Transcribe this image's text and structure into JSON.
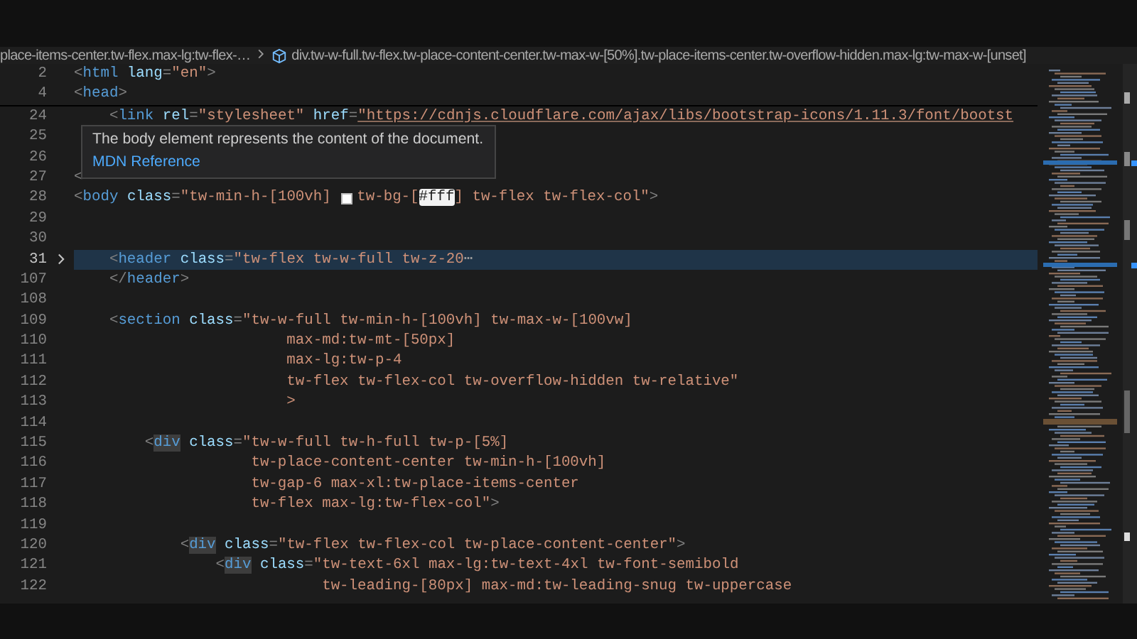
{
  "breadcrumbs": [
    {
      "text": "place-items-center.tw-flex.max-lg:tw-flex-…",
      "icon": false
    },
    {
      "text": "div.tw-w-full.tw-flex.tw-place-content-center.tw-max-w-[50%].tw-place-items-center.tw-overflow-hidden.max-lg:tw-max-w-[unset]",
      "icon": true
    }
  ],
  "sticky_lines": [
    {
      "number": "2",
      "tokens": [
        {
          "kind": "punct",
          "text": "<"
        },
        {
          "kind": "tag",
          "text": "html"
        },
        {
          "kind": "attr",
          "text": " lang"
        },
        {
          "kind": "punct",
          "text": "="
        },
        {
          "kind": "string",
          "text": "\"en\""
        },
        {
          "kind": "punct",
          "text": ">"
        }
      ]
    },
    {
      "number": "4",
      "tokens": [
        {
          "kind": "punct",
          "text": "<"
        },
        {
          "kind": "tag",
          "text": "head"
        },
        {
          "kind": "punct",
          "text": ">"
        }
      ]
    }
  ],
  "lines": [
    {
      "number": "24",
      "current": false,
      "folded": false,
      "tokens": [
        {
          "kind": "punct",
          "text": "    <"
        },
        {
          "kind": "tag",
          "text": "link"
        },
        {
          "kind": "attr",
          "text": " rel"
        },
        {
          "kind": "punct",
          "text": "="
        },
        {
          "kind": "string",
          "text": "\"stylesheet\""
        },
        {
          "kind": "attr",
          "text": " href"
        },
        {
          "kind": "punct",
          "text": "="
        },
        {
          "kind": "link",
          "text": "\"https://cdnjs.cloudflare.com/ajax/libs/bootstrap-icons/1.11.3/font/bootst"
        }
      ]
    },
    {
      "number": "25",
      "current": false,
      "folded": false
    },
    {
      "number": "26",
      "current": false,
      "folded": false
    },
    {
      "number": "27",
      "current": false,
      "folded": false,
      "tokens": [
        {
          "kind": "punct",
          "text": "<"
        }
      ]
    },
    {
      "number": "28",
      "current": false,
      "folded": false,
      "tokens": [
        {
          "kind": "punct",
          "text": "<"
        },
        {
          "kind": "tag",
          "text": "body"
        },
        {
          "kind": "attr",
          "text": " class"
        },
        {
          "kind": "punct",
          "text": "="
        },
        {
          "kind": "string",
          "text": "\"tw-min-h-[100vh] "
        },
        {
          "kind": "swatch",
          "color": "#ffffff"
        },
        {
          "kind": "string",
          "text": "tw-bg-["
        },
        {
          "kind": "selected",
          "text": "#fff"
        },
        {
          "kind": "string",
          "text": "] tw-flex tw-flex-col\""
        },
        {
          "kind": "punct",
          "text": ">"
        }
      ]
    },
    {
      "number": "29",
      "current": false,
      "folded": false
    },
    {
      "number": "30",
      "current": false,
      "folded": false
    },
    {
      "number": "31",
      "current": true,
      "folded": true,
      "tokens": [
        {
          "kind": "punct",
          "text": "    <"
        },
        {
          "kind": "tag",
          "text": "header"
        },
        {
          "kind": "attr",
          "text": " class"
        },
        {
          "kind": "punct",
          "text": "="
        },
        {
          "kind": "string",
          "text": "\"tw-flex tw-w-full tw-z-20"
        },
        {
          "kind": "ellipsis",
          "text": "⋯"
        }
      ]
    },
    {
      "number": "107",
      "current": false,
      "folded": false,
      "tokens": [
        {
          "kind": "punct",
          "text": "    </"
        },
        {
          "kind": "tag",
          "text": "header"
        },
        {
          "kind": "punct",
          "text": ">"
        }
      ]
    },
    {
      "number": "108",
      "current": false,
      "folded": false
    },
    {
      "number": "109",
      "current": false,
      "folded": false,
      "tokens": [
        {
          "kind": "punct",
          "text": "    <"
        },
        {
          "kind": "tag",
          "text": "section"
        },
        {
          "kind": "attr",
          "text": " class"
        },
        {
          "kind": "punct",
          "text": "="
        },
        {
          "kind": "string",
          "text": "\"tw-w-full tw-min-h-[100vh] tw-max-w-[100vw]"
        }
      ]
    },
    {
      "number": "110",
      "current": false,
      "folded": false,
      "tokens": [
        {
          "kind": "string",
          "text": "                        max-md:tw-mt-[50px]"
        }
      ]
    },
    {
      "number": "111",
      "current": false,
      "folded": false,
      "tokens": [
        {
          "kind": "string",
          "text": "                        max-lg:tw-p-4"
        }
      ]
    },
    {
      "number": "112",
      "current": false,
      "folded": false,
      "tokens": [
        {
          "kind": "string",
          "text": "                        tw-flex tw-flex-col tw-overflow-hidden tw-relative\""
        }
      ]
    },
    {
      "number": "113",
      "current": false,
      "folded": false,
      "tokens": [
        {
          "kind": "string",
          "text": "                        >"
        }
      ]
    },
    {
      "number": "114",
      "current": false,
      "folded": false
    },
    {
      "number": "115",
      "current": false,
      "folded": false,
      "tokens": [
        {
          "kind": "punct",
          "text": "        <"
        },
        {
          "kind": "tag-match",
          "text": "div"
        },
        {
          "kind": "attr",
          "text": " class"
        },
        {
          "kind": "punct",
          "text": "="
        },
        {
          "kind": "string",
          "text": "\"tw-w-full tw-h-full tw-p-[5%]"
        }
      ]
    },
    {
      "number": "116",
      "current": false,
      "folded": false,
      "tokens": [
        {
          "kind": "string",
          "text": "                    tw-place-content-center tw-min-h-[100vh]"
        }
      ]
    },
    {
      "number": "117",
      "current": false,
      "folded": false,
      "tokens": [
        {
          "kind": "string",
          "text": "                    tw-gap-6 max-xl:tw-place-items-center"
        }
      ]
    },
    {
      "number": "118",
      "current": false,
      "folded": false,
      "tokens": [
        {
          "kind": "string",
          "text": "                    tw-flex max-lg:tw-flex-col\""
        },
        {
          "kind": "punct",
          "text": ">"
        }
      ]
    },
    {
      "number": "119",
      "current": false,
      "folded": false
    },
    {
      "number": "120",
      "current": false,
      "folded": false,
      "tokens": [
        {
          "kind": "punct",
          "text": "            <"
        },
        {
          "kind": "tag-match",
          "text": "div"
        },
        {
          "kind": "attr",
          "text": " class"
        },
        {
          "kind": "punct",
          "text": "="
        },
        {
          "kind": "string",
          "text": "\"tw-flex tw-flex-col tw-place-content-center\""
        },
        {
          "kind": "punct",
          "text": ">"
        }
      ]
    },
    {
      "number": "121",
      "current": false,
      "folded": false,
      "tokens": [
        {
          "kind": "punct",
          "text": "                <"
        },
        {
          "kind": "tag-match",
          "text": "div"
        },
        {
          "kind": "attr",
          "text": " class"
        },
        {
          "kind": "punct",
          "text": "="
        },
        {
          "kind": "string",
          "text": "\"tw-text-6xl max-lg:tw-text-4xl tw-font-semibold"
        }
      ]
    },
    {
      "number": "122",
      "current": false,
      "folded": false,
      "tokens": [
        {
          "kind": "string",
          "text": "                            tw-leading-[80px] max-md:tw-leading-snug tw-uppercase"
        }
      ]
    }
  ],
  "hover": {
    "description": "The body element represents the content of the document.",
    "link": "MDN Reference"
  }
}
